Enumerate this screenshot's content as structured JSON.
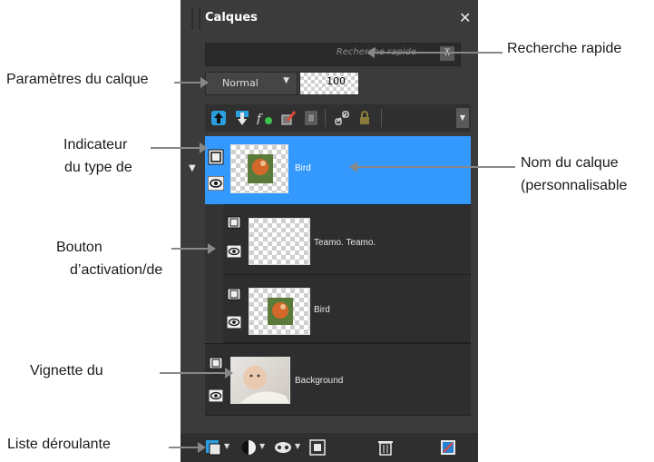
{
  "panel": {
    "title": "Calques",
    "search_placeholder": "Recherche rapide",
    "blend_mode": "Normal",
    "opacity": "100",
    "layers": [
      {
        "name": "Bird",
        "selected": true
      },
      {
        "name": "Teamo. Teamo."
      },
      {
        "name": "Bird"
      },
      {
        "name": "Background"
      }
    ]
  },
  "annotations": {
    "search": "Recherche rapide",
    "layer_params": "Paramètres du calque",
    "type_indicator_1": "Indicateur",
    "type_indicator_2": "du type de",
    "layer_name_1": "Nom du calque",
    "layer_name_2": "(personnalisable",
    "toggle_1": "Bouton",
    "toggle_2": "d’activation/de",
    "thumbnail": "Vignette du",
    "dropdown": "Liste déroulante"
  },
  "colors": {
    "panel_bg": "#3b3b3b",
    "selection": "#3399ff",
    "arrow": "#888888"
  },
  "icons": [
    "close-icon",
    "collapse-icon",
    "chevron-down-icon",
    "move-up-icon",
    "move-down-icon",
    "fx-icon",
    "brush-mask-icon",
    "mask-icon",
    "link-icon",
    "lock-icon",
    "eye-icon",
    "layer-type-icon",
    "new-layer-icon",
    "adjustment-icon",
    "mask-group-icon",
    "fit-icon",
    "trash-icon",
    "settings-icon"
  ]
}
